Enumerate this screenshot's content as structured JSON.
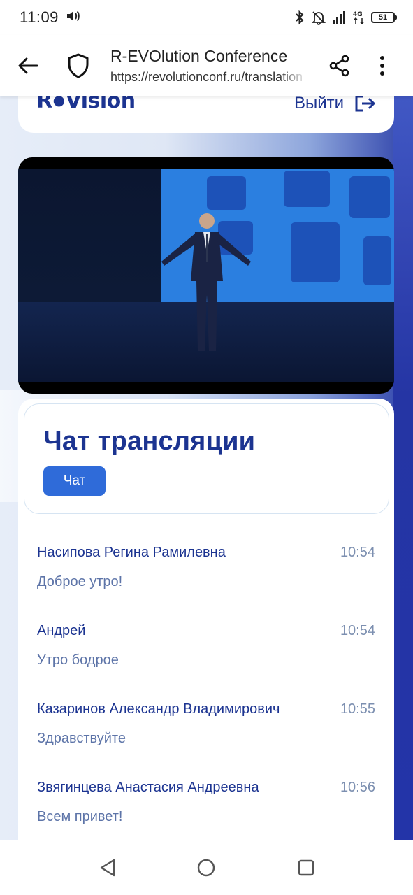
{
  "status_bar": {
    "time": "11:09",
    "battery": "51",
    "icons": [
      "volume-icon",
      "bluetooth-icon",
      "bell-off-icon",
      "signal-icon",
      "network-4g-icon",
      "battery-icon"
    ]
  },
  "browser": {
    "page_title": "R-EVOlution Conference",
    "url": "https://revolutionconf.ru/translation",
    "icons": [
      "back-arrow-icon",
      "shield-icon",
      "share-icon",
      "more-vertical-icon"
    ]
  },
  "header": {
    "logo_text_left": "R",
    "logo_text_right": "Vision",
    "logout_label": "Выйти"
  },
  "chat": {
    "title": "Чат трансляции",
    "tab_label": "Чат",
    "messages": [
      {
        "name": "Насипова Регина Рамилевна",
        "time": "10:54",
        "text": "Доброе утро!"
      },
      {
        "name": "Андрей",
        "time": "10:54",
        "text": "Утро бодрое"
      },
      {
        "name": "Казаринов Александр Владимирович",
        "time": "10:55",
        "text": "Здравствуйте"
      },
      {
        "name": "Звягинцева Анастасия Андреевна",
        "time": "10:56",
        "text": "Всем привет!"
      }
    ]
  },
  "colors": {
    "brand": "#1c3491",
    "tab": "#2f6bd9",
    "message_text": "#5d74a8",
    "time": "#7c8fb0"
  },
  "nav_bar": {
    "icons": [
      "nav-back-icon",
      "nav-home-icon",
      "nav-recents-icon"
    ]
  }
}
